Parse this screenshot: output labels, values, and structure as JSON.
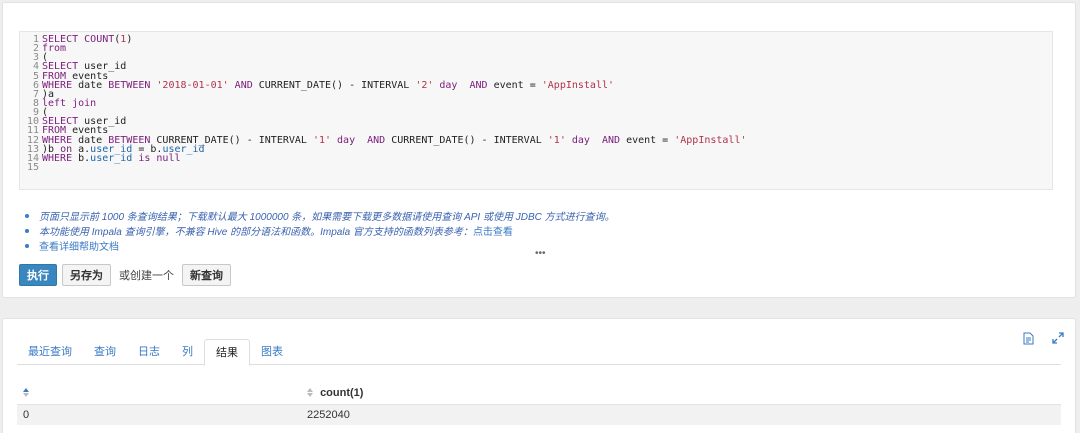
{
  "editor": {
    "lines": [
      [
        {
          "t": "SELECT ",
          "c": "kw"
        },
        {
          "t": "COUNT",
          "c": "kw"
        },
        {
          "t": "(",
          "c": "txt"
        },
        {
          "t": "1",
          "c": "num"
        },
        {
          "t": ")",
          "c": "txt"
        }
      ],
      [
        {
          "t": "from",
          "c": "kw"
        }
      ],
      [
        {
          "t": "(",
          "c": "txt"
        }
      ],
      [
        {
          "t": "SELECT ",
          "c": "kw"
        },
        {
          "t": "user_id",
          "c": "txt"
        }
      ],
      [
        {
          "t": "FROM ",
          "c": "kw"
        },
        {
          "t": "events",
          "c": "txt"
        }
      ],
      [
        {
          "t": "WHERE ",
          "c": "kw"
        },
        {
          "t": "date ",
          "c": "txt"
        },
        {
          "t": "BETWEEN ",
          "c": "kw"
        },
        {
          "t": "'2018-01-01'",
          "c": "str"
        },
        {
          "t": " AND ",
          "c": "kw"
        },
        {
          "t": "CURRENT_DATE() - INTERVAL ",
          "c": "txt"
        },
        {
          "t": "'2'",
          "c": "str"
        },
        {
          "t": " day  ",
          "c": "kw"
        },
        {
          "t": "AND ",
          "c": "kw"
        },
        {
          "t": "event = ",
          "c": "txt"
        },
        {
          "t": "'AppInstall'",
          "c": "str"
        }
      ],
      [
        {
          "t": ")a",
          "c": "txt"
        }
      ],
      [
        {
          "t": "left join",
          "c": "kw"
        }
      ],
      [
        {
          "t": "(",
          "c": "txt"
        }
      ],
      [
        {
          "t": "SELECT ",
          "c": "kw"
        },
        {
          "t": "user_id",
          "c": "txt"
        }
      ],
      [
        {
          "t": "FROM ",
          "c": "kw"
        },
        {
          "t": "events",
          "c": "txt"
        }
      ],
      [
        {
          "t": "WHERE ",
          "c": "kw"
        },
        {
          "t": "date ",
          "c": "txt"
        },
        {
          "t": "BETWEEN ",
          "c": "kw"
        },
        {
          "t": "CURRENT_DATE() - INTERVAL ",
          "c": "txt"
        },
        {
          "t": "'1'",
          "c": "str"
        },
        {
          "t": " day  ",
          "c": "kw"
        },
        {
          "t": "AND ",
          "c": "kw"
        },
        {
          "t": "CURRENT_DATE() - INTERVAL ",
          "c": "txt"
        },
        {
          "t": "'1'",
          "c": "str"
        },
        {
          "t": " day  ",
          "c": "kw"
        },
        {
          "t": "AND ",
          "c": "kw"
        },
        {
          "t": "event = ",
          "c": "txt"
        },
        {
          "t": "'AppInstall'",
          "c": "str"
        }
      ],
      [
        {
          "t": ")b ",
          "c": "txt"
        },
        {
          "t": "on ",
          "c": "kw"
        },
        {
          "t": "a.",
          "c": "txt"
        },
        {
          "t": "user_id",
          "c": "ref"
        },
        {
          "t": " = b.",
          "c": "txt"
        },
        {
          "t": "user_id",
          "c": "ref"
        }
      ],
      [
        {
          "t": "WHERE ",
          "c": "kw"
        },
        {
          "t": "b.",
          "c": "txt"
        },
        {
          "t": "user_id",
          "c": "ref"
        },
        {
          "t": " is null",
          "c": "kw"
        }
      ],
      []
    ]
  },
  "notes": {
    "n1": "页面只显示前 1000 条查询结果；下载默认最大 1000000 条，如果需要下载更多数据请使用查询 API 或使用 JDBC 方式进行查询。",
    "n2": "本功能使用 Impala 查询引擎，不兼容 Hive 的部分语法和函数。Impala 官方支持的函数列表参考：",
    "n2_link": "点击查看",
    "n3": "查看详细帮助文档"
  },
  "more_dots": "•••",
  "actions": {
    "run": "执行",
    "save_as": "另存为",
    "or_create": "或创建一个",
    "new_query": "新查询"
  },
  "tabs": [
    "最近查询",
    "查询",
    "日志",
    "列",
    "结果",
    "图表"
  ],
  "active_tab": "结果",
  "icons": {
    "export": "download-icon",
    "expand": "expand-icon"
  },
  "result": {
    "columns": [
      "",
      "count(1)"
    ],
    "rows": [
      [
        "0",
        "2252040"
      ]
    ]
  }
}
